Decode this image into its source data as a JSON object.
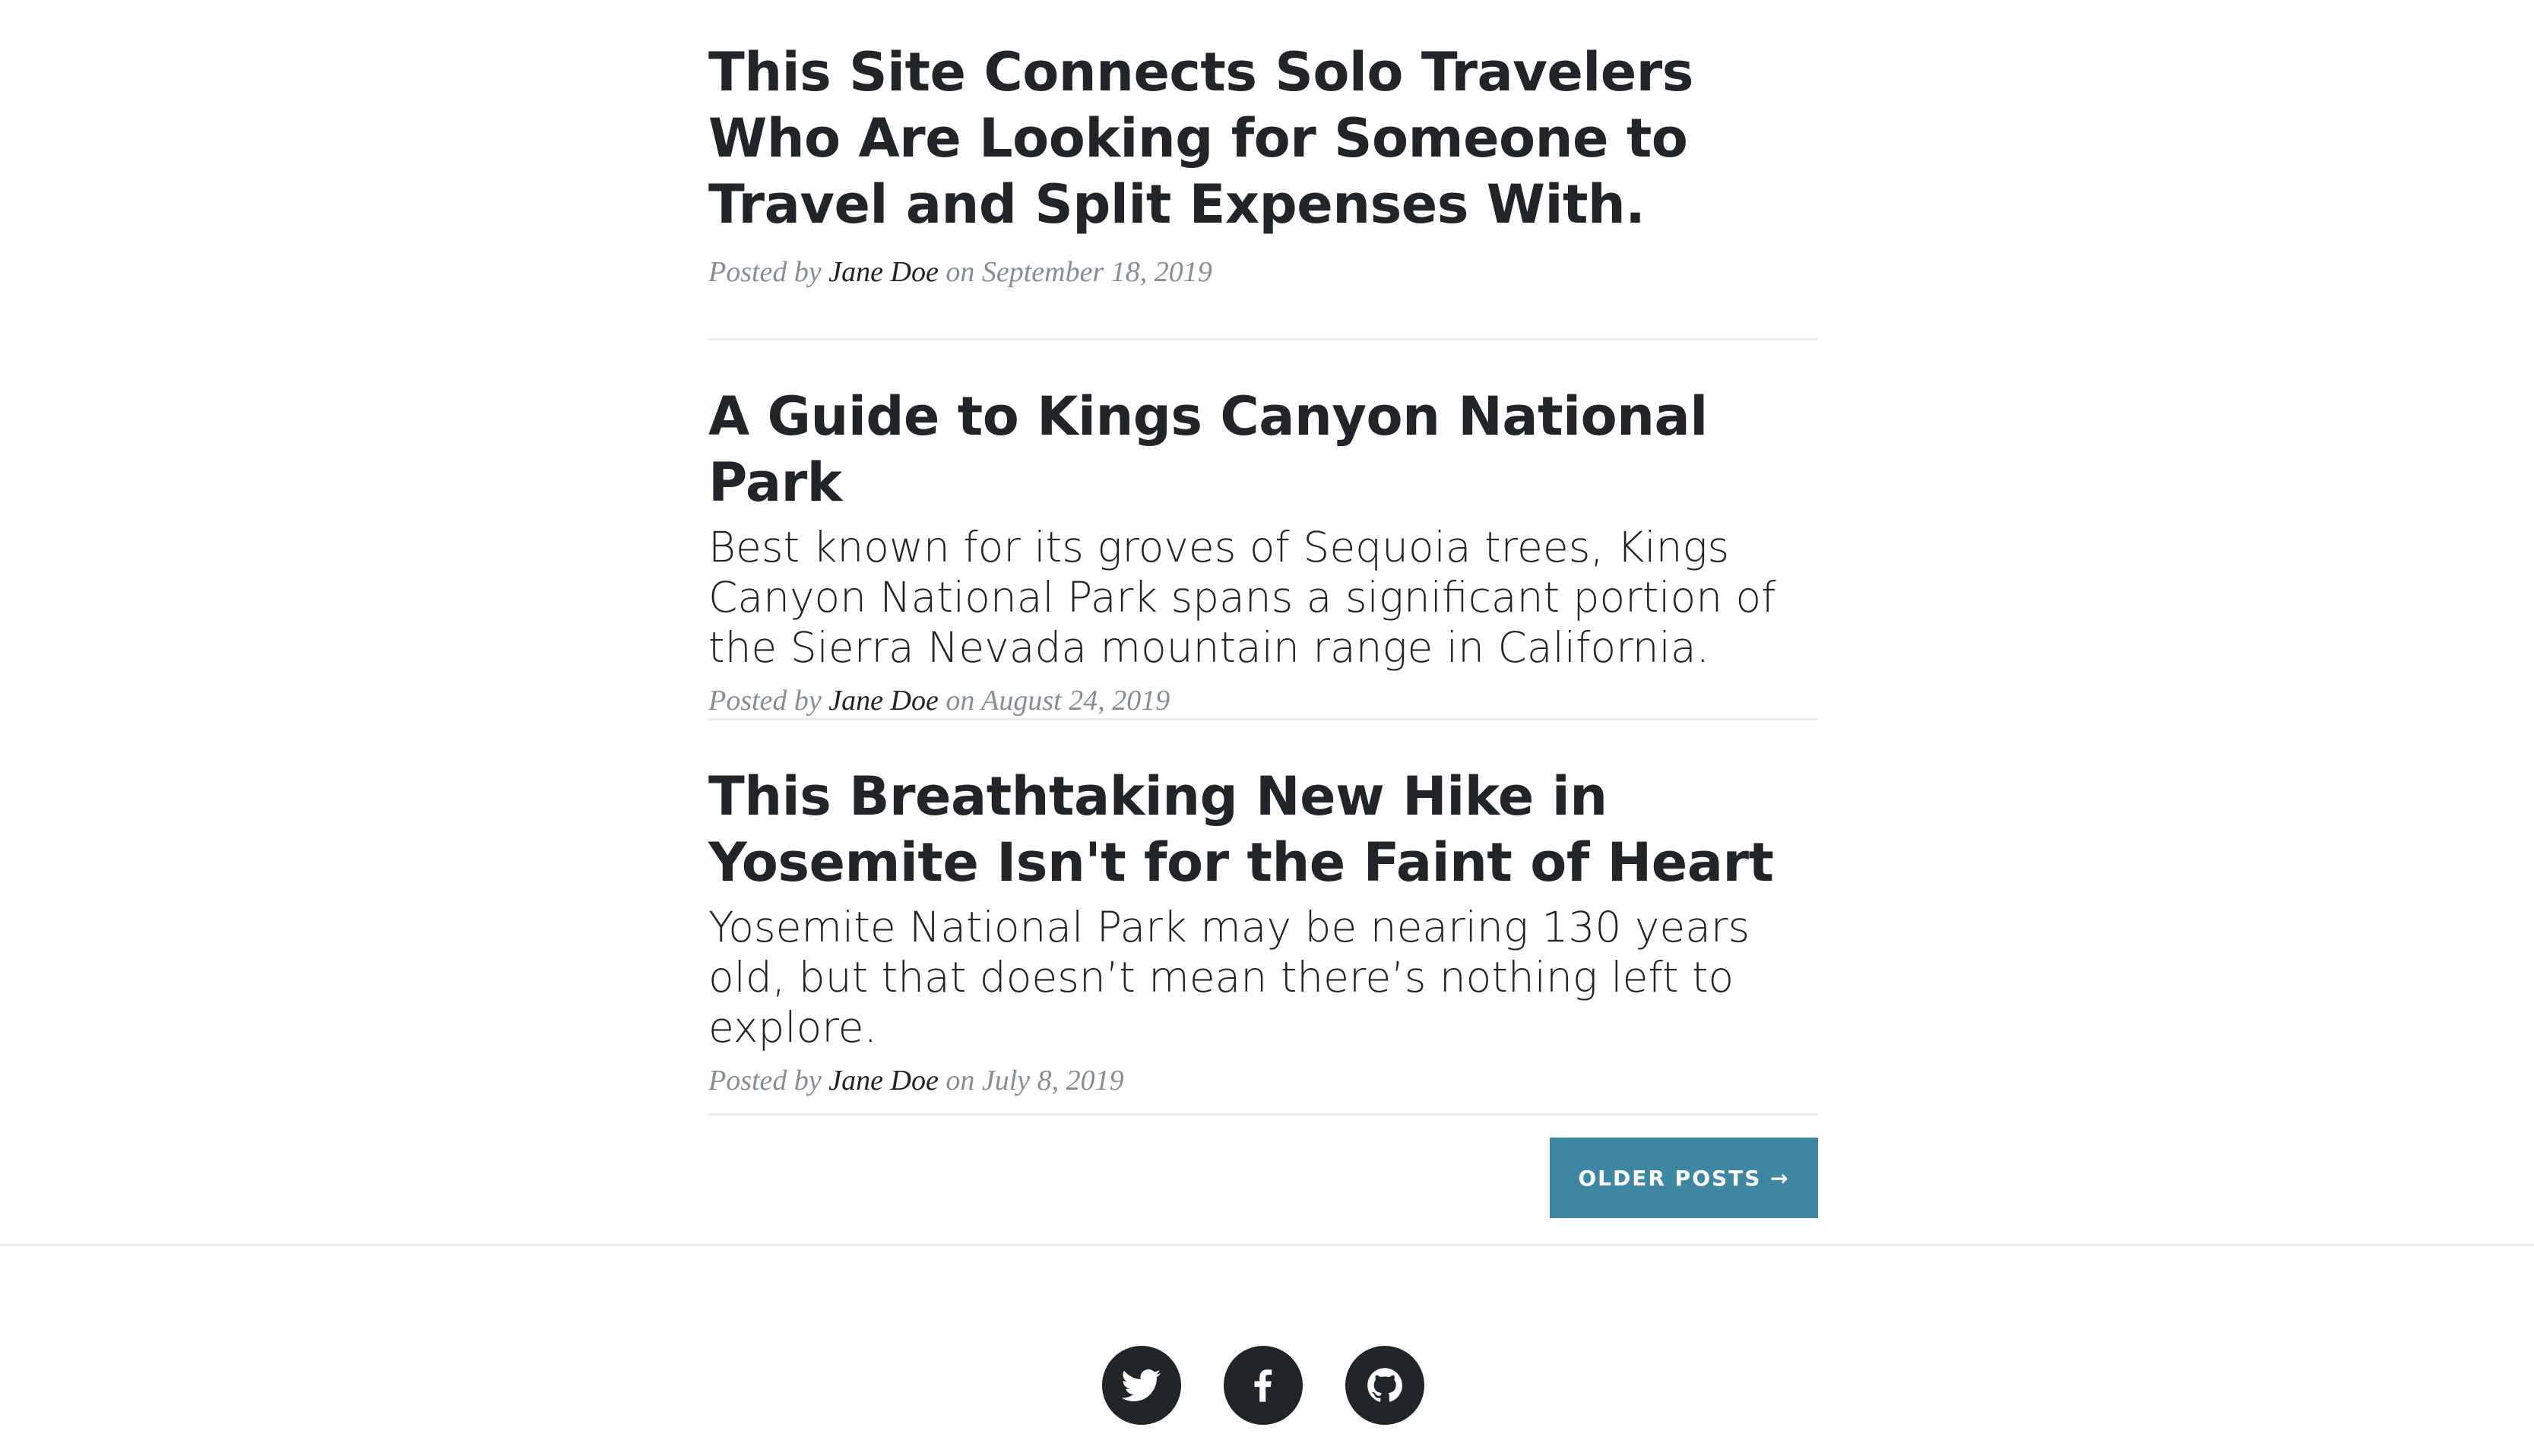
{
  "posts": [
    {
      "title": "This Site Connects Solo Travelers Who Are Looking for Someone to Travel and Split Expenses With.",
      "subtitle": "",
      "meta_prefix": "Posted by",
      "author": "Jane Doe",
      "meta_on": "on",
      "date": "September 18, 2019"
    },
    {
      "title": "A Guide to Kings Canyon National Park",
      "subtitle": "Best known for its groves of Sequoia trees, Kings Canyon National Park spans a significant portion of the Sierra Nevada mountain range in California.",
      "meta_prefix": "Posted by",
      "author": "Jane Doe",
      "meta_on": "on",
      "date": "August 24, 2019"
    },
    {
      "title": "This Breathtaking New Hike in Yosemite Isn't for the Faint of Heart",
      "subtitle": "Yosemite National Park may be nearing 130 years old, but that doesn’t mean there’s nothing left to explore.",
      "meta_prefix": "Posted by",
      "author": "Jane Doe",
      "meta_on": "on",
      "date": "July 8, 2019"
    }
  ],
  "pager": {
    "older_label": "Older Posts →"
  },
  "footer": {
    "social": [
      {
        "icon": "twitter-icon"
      },
      {
        "icon": "facebook-icon"
      },
      {
        "icon": "github-icon"
      }
    ]
  },
  "colors": {
    "text": "#212529",
    "meta": "#868e96",
    "button": "#3d87a2",
    "divider": "#e9ecef"
  }
}
